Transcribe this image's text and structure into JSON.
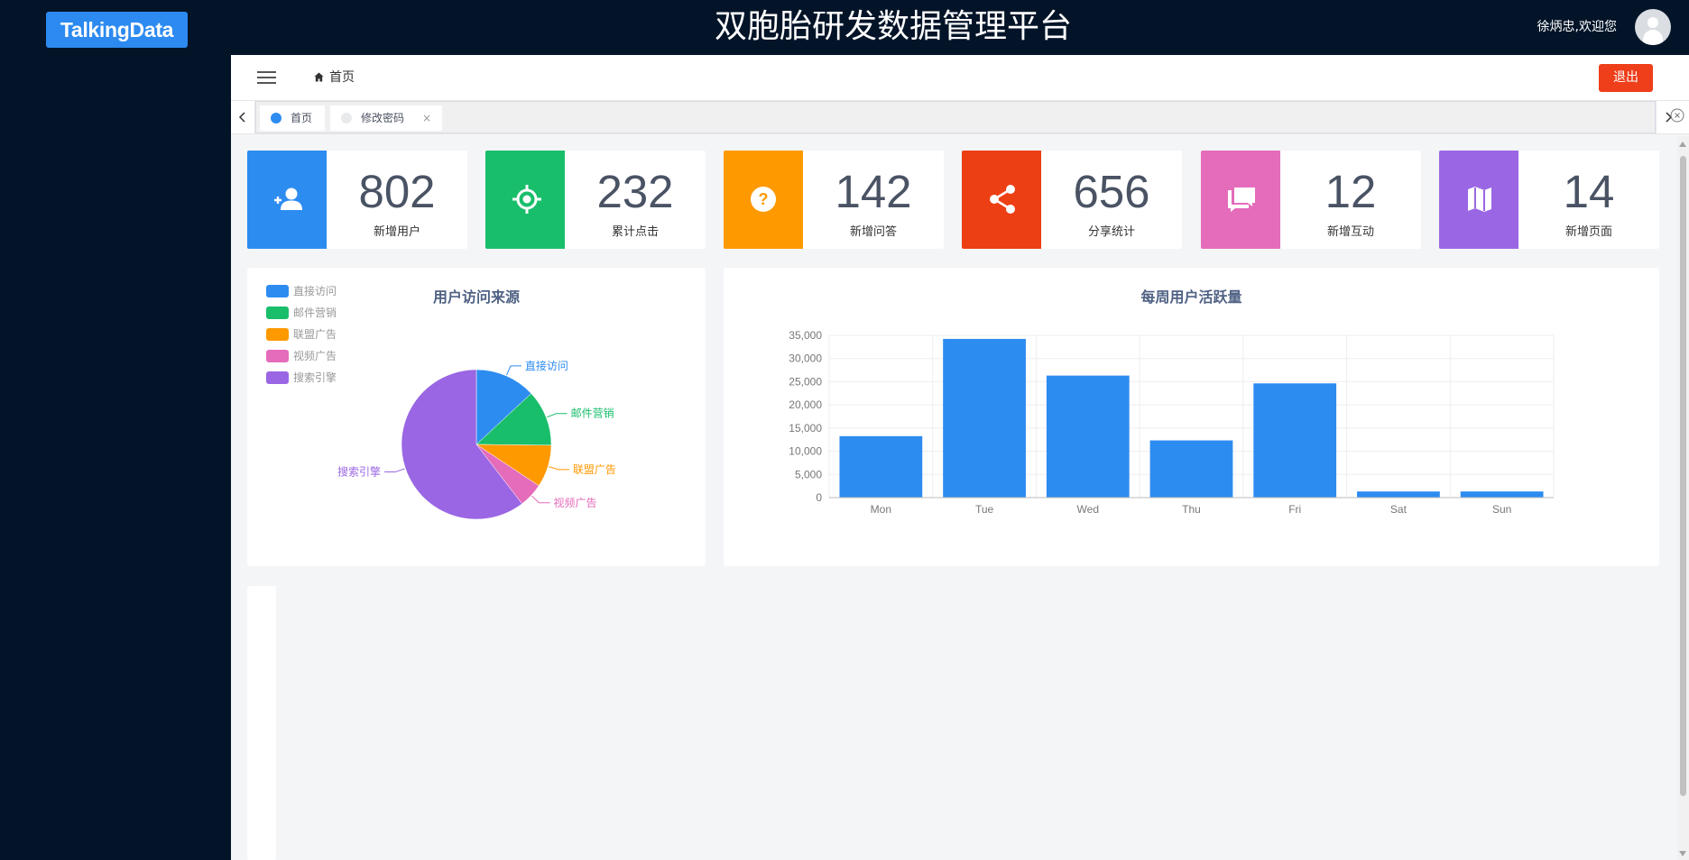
{
  "header": {
    "logo_text": "TalkingData",
    "title": "双胞胎研发数据管理平台",
    "welcome": "徐炳忠,欢迎您"
  },
  "navbar": {
    "breadcrumb": "首页",
    "logout_label": "退出"
  },
  "tabs": [
    {
      "label": "首页",
      "active": true,
      "dot_color": "#2d8cf0"
    },
    {
      "label": "修改密码",
      "active": false,
      "dot_color": "#e8eaec",
      "close": "×"
    }
  ],
  "stats": [
    {
      "value": "802",
      "label": "新增用户",
      "color": "#2d8cf0",
      "icon": "user-add-icon"
    },
    {
      "value": "232",
      "label": "累计点击",
      "color": "#19be6b",
      "icon": "target-icon"
    },
    {
      "value": "142",
      "label": "新增问答",
      "color": "#ff9900",
      "icon": "question-icon"
    },
    {
      "value": "656",
      "label": "分享统计",
      "color": "#ed3f14",
      "icon": "share-icon"
    },
    {
      "value": "12",
      "label": "新增互动",
      "color": "#e46cbb",
      "icon": "chat-icon"
    },
    {
      "value": "14",
      "label": "新增页面",
      "color": "#9a66e4",
      "icon": "map-icon"
    }
  ],
  "pie_panel": {
    "title": "用户访问来源"
  },
  "bar_panel": {
    "title": "每周用户活跃量"
  },
  "chart_data": [
    {
      "type": "pie",
      "title": "用户访问来源",
      "legend_position": "top-left",
      "slices": [
        {
          "name": "直接访问",
          "value": 335,
          "color": "#2d8cf0"
        },
        {
          "name": "邮件营销",
          "value": 310,
          "color": "#19be6b"
        },
        {
          "name": "联盟广告",
          "value": 234,
          "color": "#ff9900"
        },
        {
          "name": "视频广告",
          "value": 135,
          "color": "#e46cbb"
        },
        {
          "name": "搜索引擎",
          "value": 1548,
          "color": "#9a66e4"
        }
      ]
    },
    {
      "type": "bar",
      "title": "每周用户活跃量",
      "categories": [
        "Mon",
        "Tue",
        "Wed",
        "Thu",
        "Fri",
        "Sat",
        "Sun"
      ],
      "values": [
        13253,
        34235,
        26321,
        12340,
        24643,
        1322,
        1324
      ],
      "ylim": [
        0,
        35000
      ],
      "yticks": [
        "0",
        "5,000",
        "10,000",
        "15,000",
        "20,000",
        "25,000",
        "30,000",
        "35,000"
      ],
      "grid": true,
      "color": "#2d8cf0"
    }
  ]
}
